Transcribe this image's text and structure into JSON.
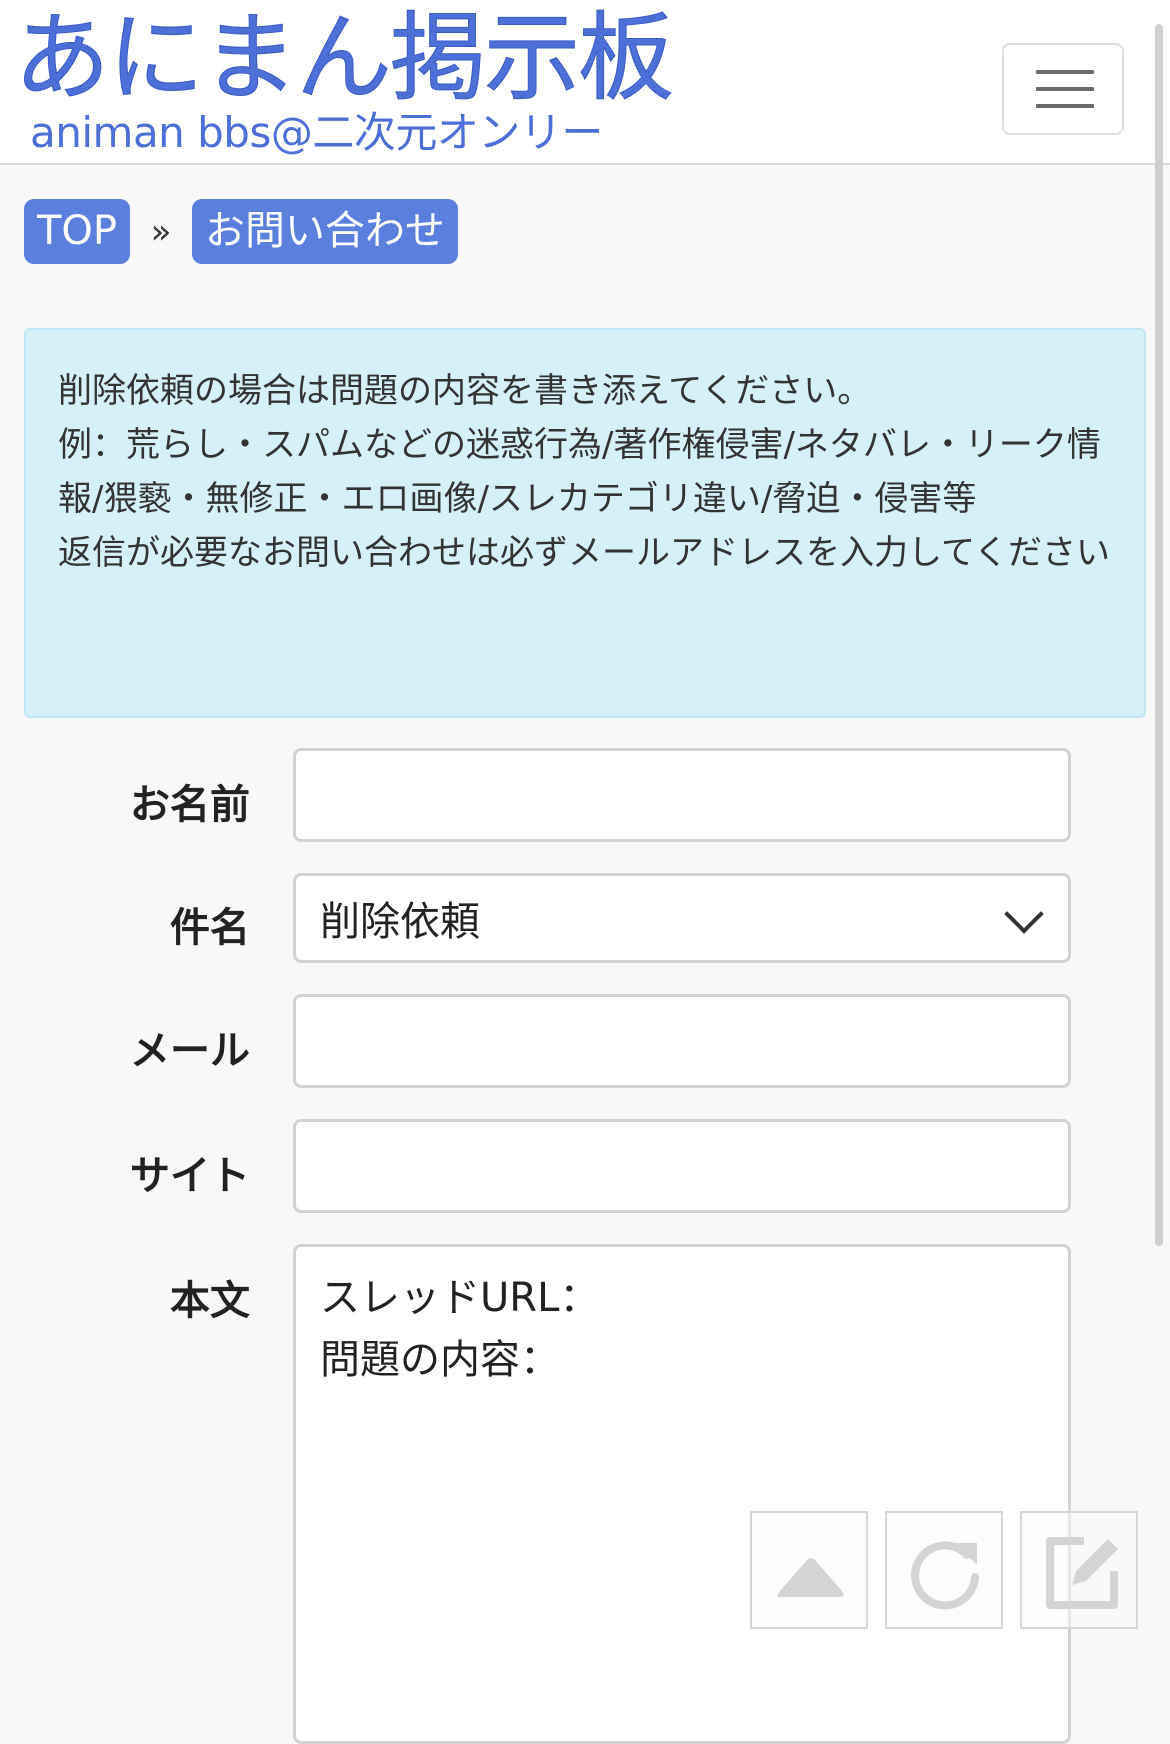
{
  "header": {
    "logo_main": "あにまん掲示板",
    "logo_sub": "animan bbs@二次元オンリー",
    "menu_icon": "hamburger-menu-icon"
  },
  "breadcrumb": {
    "items": [
      {
        "label": "TOP"
      },
      {
        "label": "お問い合わせ"
      }
    ],
    "separator": "»"
  },
  "notice": {
    "lines": [
      "削除依頼の場合は問題の内容を書き添えてください。",
      "例：荒らし・スパムなどの迷惑行為/著作権侵害/ネタバレ・リーク情報/猥褻・無修正・エロ画像/スレカテゴリ違い/脅迫・侵害等",
      "返信が必要なお問い合わせは必ずメールアドレスを入力してください"
    ],
    "colors": {
      "background": "#d6f0f8",
      "border": "#bfe6f2"
    }
  },
  "form": {
    "name": {
      "label": "お名前",
      "value": ""
    },
    "subject": {
      "label": "件名",
      "selected": "削除依頼"
    },
    "email": {
      "label": "メール",
      "value": ""
    },
    "site": {
      "label": "サイト",
      "value": ""
    },
    "body": {
      "label": "本文",
      "value": "スレッドURL：\n問題の内容："
    }
  },
  "floating_buttons": [
    {
      "icon": "scroll-to-top-icon"
    },
    {
      "icon": "reload-icon"
    },
    {
      "icon": "compose-icon"
    }
  ],
  "colors": {
    "brand": "#4d6fd8",
    "breadcrumb_bg": "#5b7fdc"
  }
}
